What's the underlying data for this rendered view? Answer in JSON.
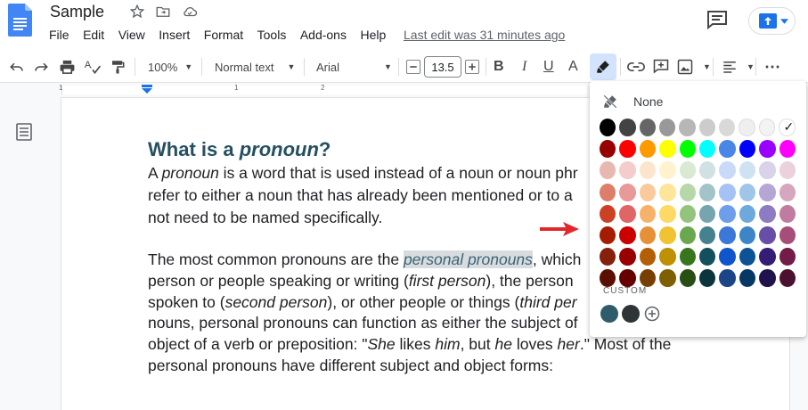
{
  "header": {
    "title": "Sample",
    "menu": [
      "File",
      "Edit",
      "View",
      "Insert",
      "Format",
      "Tools",
      "Add-ons",
      "Help"
    ],
    "last_edit": "Last edit was 31 minutes ago"
  },
  "toolbar": {
    "zoom": "100%",
    "style": "Normal text",
    "font": "Arial",
    "font_size": "13.5",
    "bold": "B",
    "italic": "I",
    "underline": "U",
    "text_color": "A",
    "more": "⋯"
  },
  "ruler": {
    "numbers": [
      "1",
      "1",
      "2"
    ]
  },
  "document": {
    "heading_prefix": "What is a ",
    "heading_italic": "pronoun",
    "heading_suffix": "?",
    "p1": [
      {
        "t": "A ",
        "i": false
      },
      {
        "t": "pronoun",
        "i": true
      },
      {
        "t": " is a word that is used instead of a noun or noun phr",
        "i": false
      }
    ],
    "p1_line2": "refer to either a noun that has already been mentioned or to a",
    "p1_line3": "not need to be named specifically.",
    "p2_line1_pre": "The most common pronouns are the ",
    "p2_line1_hl": "personal pronouns",
    "p2_line1_post": ", which",
    "p2_line2": [
      {
        "t": "person or people speaking or writing (",
        "i": false
      },
      {
        "t": "first person",
        "i": true
      },
      {
        "t": "), the person",
        "i": false
      }
    ],
    "p2_line3": [
      {
        "t": "spoken to (",
        "i": false
      },
      {
        "t": "second person",
        "i": true
      },
      {
        "t": "), or other people or things (",
        "i": false
      },
      {
        "t": "third per",
        "i": true
      }
    ],
    "p2_line4": "nouns, personal pronouns can function as either the subject of",
    "p2_line5": [
      {
        "t": "object of a verb or preposition: \"",
        "i": false
      },
      {
        "t": "She",
        "i": true
      },
      {
        "t": " likes ",
        "i": false
      },
      {
        "t": "him",
        "i": true
      },
      {
        "t": ", but ",
        "i": false
      },
      {
        "t": "he",
        "i": true
      },
      {
        "t": " loves ",
        "i": false
      },
      {
        "t": "her",
        "i": true
      },
      {
        "t": ".\" Most of the",
        "i": false
      }
    ],
    "p2_line6": "personal pronouns have different subject and object forms:"
  },
  "highlight_menu": {
    "none_label": "None",
    "custom_label": "CUSTOM",
    "selected": "#ffffff",
    "rows": [
      [
        "#000000",
        "#434343",
        "#666666",
        "#999999",
        "#b7b7b7",
        "#cccccc",
        "#d9d9d9",
        "#efefef",
        "#f3f3f3",
        "#ffffff"
      ],
      [
        "#980000",
        "#ff0000",
        "#ff9900",
        "#ffff00",
        "#00ff00",
        "#00ffff",
        "#4a86e8",
        "#0000ff",
        "#9900ff",
        "#ff00ff"
      ],
      [
        "#e6b8af",
        "#f4cccc",
        "#fce5cd",
        "#fff2cc",
        "#d9ead3",
        "#d0e0e3",
        "#c9daf8",
        "#cfe2f3",
        "#d9d2e9",
        "#ead1dc"
      ],
      [
        "#dd7e6b",
        "#ea9999",
        "#f9cb9c",
        "#ffe599",
        "#b6d7a8",
        "#a2c4c9",
        "#a4c2f4",
        "#9fc5e8",
        "#b4a7d6",
        "#d5a6bd"
      ],
      [
        "#cc4125",
        "#e06666",
        "#f6b26b",
        "#ffd966",
        "#93c47d",
        "#76a5af",
        "#6d9eeb",
        "#6fa8dc",
        "#8e7cc3",
        "#c27ba0"
      ],
      [
        "#a61c00",
        "#cc0000",
        "#e69138",
        "#f1c232",
        "#6aa84f",
        "#45818e",
        "#3c78d8",
        "#3d85c6",
        "#674ea7",
        "#a64d79"
      ],
      [
        "#85200c",
        "#990000",
        "#b45f06",
        "#bf9000",
        "#38761d",
        "#134f5c",
        "#1155cc",
        "#0b5394",
        "#351c75",
        "#741b47"
      ],
      [
        "#5b0f00",
        "#660000",
        "#783f04",
        "#7f6000",
        "#274e13",
        "#0c343d",
        "#1c4587",
        "#073763",
        "#20124d",
        "#4c1130"
      ]
    ],
    "custom": [
      "#2f5c6b",
      "#2f3437"
    ]
  }
}
